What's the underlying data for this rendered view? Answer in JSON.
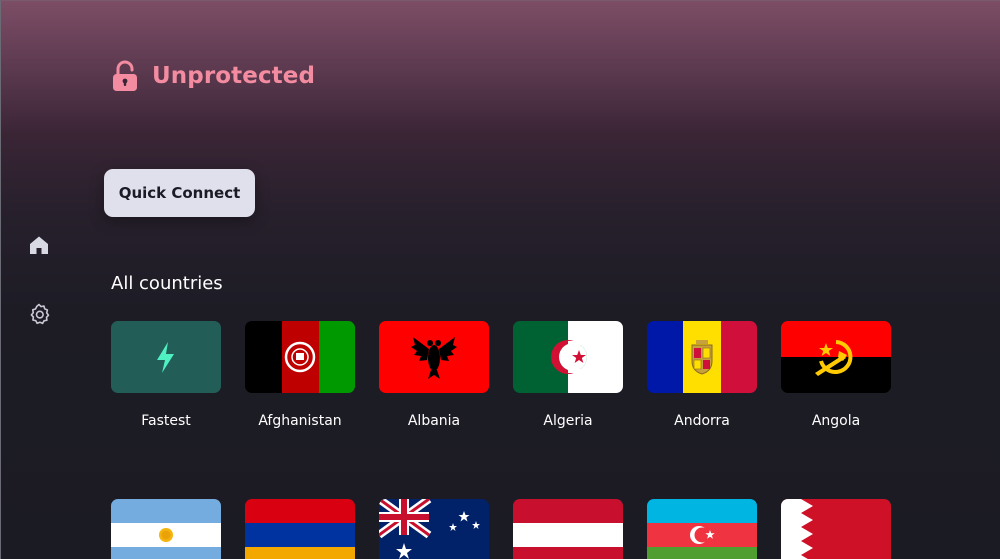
{
  "status": {
    "text": "Unprotected",
    "icon": "unlocked-padlock-icon",
    "color": "#f38ca0"
  },
  "quick_connect": {
    "label": "Quick Connect"
  },
  "nav": {
    "home_icon": "home-icon",
    "settings_icon": "gear-icon"
  },
  "countries": {
    "title": "All countries",
    "items": [
      {
        "name": "Fastest",
        "icon": "lightning-bolt-icon"
      },
      {
        "name": "Afghanistan",
        "icon": "flag-afghanistan"
      },
      {
        "name": "Albania",
        "icon": "flag-albania"
      },
      {
        "name": "Algeria",
        "icon": "flag-algeria"
      },
      {
        "name": "Andorra",
        "icon": "flag-andorra"
      },
      {
        "name": "Angola",
        "icon": "flag-angola"
      }
    ],
    "next_row_flags": [
      "flag-argentina",
      "flag-armenia",
      "flag-australia",
      "flag-austria",
      "flag-azerbaijan",
      "flag-bahrain"
    ]
  }
}
